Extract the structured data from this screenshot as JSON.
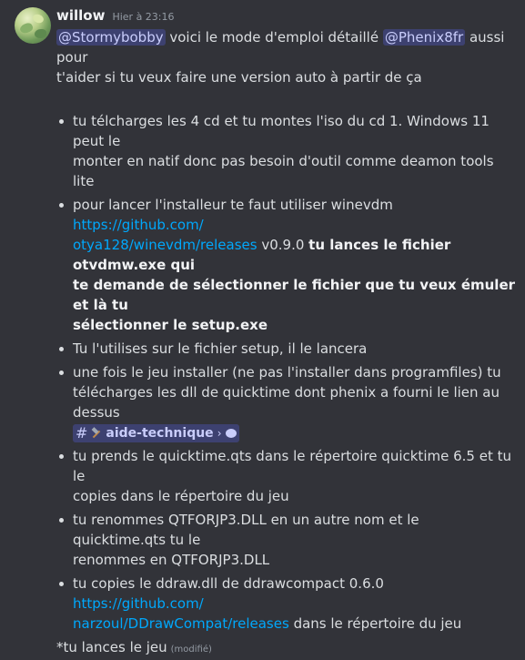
{
  "author": {
    "username": "willow",
    "timestamp": "Hier à 23:16"
  },
  "intro": {
    "mention1": "@Stormybobby",
    "text1": " voici le mode d'emploi détaillé ",
    "mention2": "@Phenix8fr",
    "text2": " aussi pour",
    "line2": "t'aider si tu veux faire une version auto à partir de ça"
  },
  "steps": [
    {
      "l1": "tu télcharges les 4 cd et tu montes l'iso du cd 1. Windows 11 peut le",
      "l2": "monter en natif donc pas besoin d'outil comme deamon tools lite"
    },
    {
      "l1a": "pour lancer l'installeur te faut utiliser  winevdm ",
      "link1": "https://github.com/",
      "link2": "otya128/winevdm/releases",
      "version": " v0.9.0 ",
      "bold1": "tu lances le fichier otvdmw.exe qui",
      "bold2": "te demande de sélectionner le fichier que tu veux émuler et là tu",
      "bold3": "sélectionner le setup.exe"
    },
    {
      "l1": "Tu l'utilises sur le fichier setup, il le lancera"
    },
    {
      "l1": "une fois le jeu installer (ne pas l'installer dans programfiles) tu",
      "l2": "télécharges les dll de quicktime dont phenix a fourni le lien au dessus",
      "channel_hash": "#",
      "channel": "aide-technique",
      "chevron": "›"
    },
    {
      "l1": "tu prends le quicktime.qts dans le répertoire quicktime 6.5 et tu le",
      "l2": "copies dans le répertoire du jeu"
    },
    {
      "l1": "tu renommes QTFORJP3.DLL en un autre nom et le quicktime.qts tu le",
      "l2": "renommes en QTFORJP3.DLL"
    },
    {
      "l1a": "tu copies le ddraw.dll de ddrawcompact 0.6.0 ",
      "link1": "https://github.com/",
      "link2": "narzoul/DDrawCompat/releases",
      "l2b": " dans le répertoire du jeu"
    }
  ],
  "footer": {
    "text": "*tu lances le jeu",
    "edited": "(modifié)"
  },
  "colors": {
    "background": "#323339",
    "mention_bg": "#5865f24d",
    "link": "#00a8fc"
  }
}
